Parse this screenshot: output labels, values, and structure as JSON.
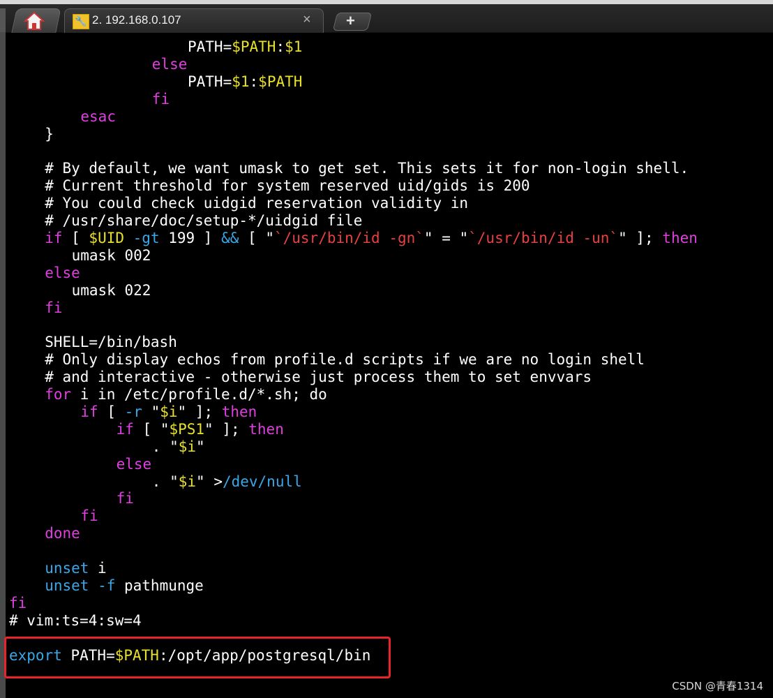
{
  "tabs": {
    "session_title": "2. 192.168.0.107",
    "close_glyph": "×",
    "newtab_glyph": "+",
    "home_icon": "home-icon",
    "session_icon": "wrench-icon"
  },
  "terminal": {
    "lines": [
      {
        "indent": 20,
        "tokens": [
          [
            "plain",
            "PATH="
          ],
          [
            "var",
            "$PATH"
          ],
          [
            "plain",
            ":"
          ],
          [
            "var",
            "$1"
          ]
        ]
      },
      {
        "indent": 16,
        "tokens": [
          [
            "keyword",
            "else"
          ]
        ]
      },
      {
        "indent": 20,
        "tokens": [
          [
            "plain",
            "PATH="
          ],
          [
            "var",
            "$1"
          ],
          [
            "plain",
            ":"
          ],
          [
            "var",
            "$PATH"
          ]
        ]
      },
      {
        "indent": 16,
        "tokens": [
          [
            "keyword",
            "fi"
          ]
        ]
      },
      {
        "indent": 8,
        "tokens": [
          [
            "keyword",
            "esac"
          ]
        ]
      },
      {
        "indent": 4,
        "tokens": [
          [
            "plain",
            "}"
          ]
        ]
      },
      {
        "indent": 0,
        "tokens": []
      },
      {
        "indent": 4,
        "tokens": [
          [
            "comment",
            "# By default, we want umask to get set. This sets it for non-login shell."
          ]
        ]
      },
      {
        "indent": 4,
        "tokens": [
          [
            "comment",
            "# Current threshold for system reserved uid/gids is 200"
          ]
        ]
      },
      {
        "indent": 4,
        "tokens": [
          [
            "comment",
            "# You could check uidgid reservation validity in"
          ]
        ]
      },
      {
        "indent": 4,
        "tokens": [
          [
            "comment",
            "# /usr/share/doc/setup-*/uidgid file"
          ]
        ]
      },
      {
        "indent": 4,
        "tokens": [
          [
            "keyword",
            "if"
          ],
          [
            "plain",
            " [ "
          ],
          [
            "var",
            "$UID"
          ],
          [
            "plain",
            " "
          ],
          [
            "builtin",
            "-gt"
          ],
          [
            "plain",
            " 199 ] "
          ],
          [
            "builtin",
            "&&"
          ],
          [
            "plain",
            " [ \""
          ],
          [
            "string",
            "`/usr/bin/id -gn`"
          ],
          [
            "plain",
            "\" = \""
          ],
          [
            "string",
            "`/usr/bin/id -un`"
          ],
          [
            "plain",
            "\" ]; "
          ],
          [
            "keyword",
            "then"
          ]
        ]
      },
      {
        "indent": 7,
        "tokens": [
          [
            "plain",
            "umask 002"
          ]
        ]
      },
      {
        "indent": 4,
        "tokens": [
          [
            "keyword",
            "else"
          ]
        ]
      },
      {
        "indent": 7,
        "tokens": [
          [
            "plain",
            "umask 022"
          ]
        ]
      },
      {
        "indent": 4,
        "tokens": [
          [
            "keyword",
            "fi"
          ]
        ]
      },
      {
        "indent": 0,
        "tokens": []
      },
      {
        "indent": 4,
        "tokens": [
          [
            "plain",
            "SHELL=/bin/bash"
          ]
        ]
      },
      {
        "indent": 4,
        "tokens": [
          [
            "comment",
            "# Only display echos from profile.d scripts if we are no login shell"
          ]
        ]
      },
      {
        "indent": 4,
        "tokens": [
          [
            "comment",
            "# and interactive - otherwise just process them to set envvars"
          ]
        ]
      },
      {
        "indent": 4,
        "tokens": [
          [
            "keyword",
            "for"
          ],
          [
            "plain",
            " i in /etc/profile.d/*.sh; do"
          ]
        ]
      },
      {
        "indent": 8,
        "tokens": [
          [
            "keyword",
            "if"
          ],
          [
            "plain",
            " [ "
          ],
          [
            "builtin",
            "-r"
          ],
          [
            "plain",
            " \""
          ],
          [
            "var",
            "$i"
          ],
          [
            "plain",
            "\" ]; "
          ],
          [
            "keyword",
            "then"
          ]
        ]
      },
      {
        "indent": 12,
        "tokens": [
          [
            "keyword",
            "if"
          ],
          [
            "plain",
            " [ \""
          ],
          [
            "var",
            "$PS1"
          ],
          [
            "plain",
            "\" ]; "
          ],
          [
            "keyword",
            "then"
          ]
        ]
      },
      {
        "indent": 16,
        "tokens": [
          [
            "plain",
            ". \""
          ],
          [
            "var",
            "$i"
          ],
          [
            "plain",
            "\""
          ]
        ]
      },
      {
        "indent": 12,
        "tokens": [
          [
            "keyword",
            "else"
          ]
        ]
      },
      {
        "indent": 16,
        "tokens": [
          [
            "plain",
            ". \""
          ],
          [
            "var",
            "$i"
          ],
          [
            "plain",
            "\" >"
          ],
          [
            "path",
            "/dev/null"
          ]
        ]
      },
      {
        "indent": 12,
        "tokens": [
          [
            "keyword",
            "fi"
          ]
        ]
      },
      {
        "indent": 8,
        "tokens": [
          [
            "keyword",
            "fi"
          ]
        ]
      },
      {
        "indent": 4,
        "tokens": [
          [
            "keyword",
            "done"
          ]
        ]
      },
      {
        "indent": 0,
        "tokens": []
      },
      {
        "indent": 4,
        "tokens": [
          [
            "builtin",
            "unset"
          ],
          [
            "plain",
            " i"
          ]
        ]
      },
      {
        "indent": 4,
        "tokens": [
          [
            "builtin",
            "unset"
          ],
          [
            "plain",
            " "
          ],
          [
            "builtin",
            "-f"
          ],
          [
            "plain",
            " pathmunge"
          ]
        ]
      },
      {
        "indent": 0,
        "tokens": [
          [
            "keyword",
            "fi"
          ]
        ]
      },
      {
        "indent": 0,
        "tokens": [
          [
            "comment",
            "# vim:ts=4:sw=4"
          ]
        ]
      },
      {
        "indent": 0,
        "tokens": []
      },
      {
        "indent": 0,
        "tokens": [
          [
            "export",
            "export"
          ],
          [
            "plain",
            " PATH="
          ],
          [
            "var",
            "$PATH"
          ],
          [
            "plain",
            ":/opt/app/postgresql/bin"
          ]
        ]
      }
    ]
  },
  "colors": {
    "keyword": "#e03fe0",
    "variable": "#e8e02a",
    "string": "#e84040",
    "builtin": "#3aa8e8",
    "highlight_border": "#e8242a"
  },
  "watermark": "CSDN @青春1314"
}
